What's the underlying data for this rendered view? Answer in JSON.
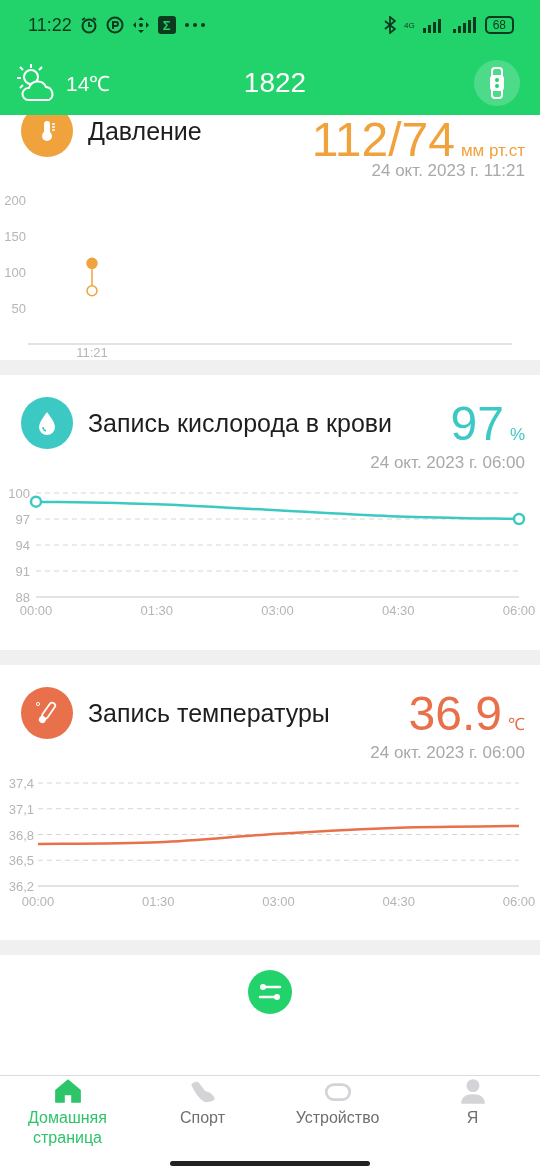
{
  "status_bar": {
    "time": "11:22",
    "badge": "Σ",
    "network": "4G",
    "battery": "68"
  },
  "header": {
    "temperature": "14℃",
    "steps": "1822"
  },
  "cards": [
    {
      "kind": "pressure",
      "title": "Давление",
      "value": "112/74",
      "unit": "мм рт.ст",
      "date": "24 окт. 2023 г. 11:21",
      "color": "#f0a23c",
      "chart_data": {
        "type": "scatter",
        "categories": [
          "11:21"
        ],
        "series": [
          {
            "color": "#f0a23c",
            "values": [
              112
            ]
          },
          {
            "color": "#f0a23c",
            "values": [
              74
            ]
          }
        ],
        "ylim": [
          0,
          200
        ],
        "yticks": [
          50,
          100,
          150,
          200
        ]
      }
    },
    {
      "kind": "oxygen",
      "title": "Запись кислорода в крови",
      "value": "97",
      "unit": "%",
      "date": "24 окт. 2023 г. 06:00",
      "color": "#3cc9c4",
      "chart_data": {
        "type": "line",
        "grid": true,
        "categories": [
          "00:00",
          "01:30",
          "03:00",
          "04:30",
          "06:00"
        ],
        "series": [
          {
            "color": "#3cc9c4",
            "marker": true,
            "values": [
              99,
              98.7,
              98,
              97.3,
              97
            ]
          }
        ],
        "ylim": [
          88,
          100
        ],
        "yticks": [
          88,
          91,
          94,
          97,
          100
        ]
      }
    },
    {
      "kind": "temperature",
      "title": "Запись температуры",
      "value": "36.9",
      "unit": "℃",
      "date": "24 окт. 2023 г. 06:00",
      "color": "#e8704a",
      "chart_data": {
        "type": "line",
        "grid": true,
        "categories": [
          "00:00",
          "01:30",
          "03:00",
          "04:30",
          "06:00"
        ],
        "series": [
          {
            "color": "#e8704a",
            "values": [
              36.69,
              36.71,
              36.81,
              36.88,
              36.9
            ]
          }
        ],
        "ylim": [
          36.2,
          37.4
        ],
        "yticks": [
          {
            "value": 36.2,
            "label": "36,2"
          },
          {
            "value": 36.5,
            "label": "36,5"
          },
          {
            "value": 36.8,
            "label": "36,8"
          },
          {
            "value": 37.1,
            "label": "37,1"
          },
          {
            "value": 37.4,
            "label": "37,4"
          }
        ]
      }
    }
  ],
  "nav": [
    {
      "label": "Домашняя страница",
      "selected": true
    },
    {
      "label": "Спорт",
      "selected": false
    },
    {
      "label": "Устройство",
      "selected": false
    },
    {
      "label": "Я",
      "selected": false
    }
  ]
}
